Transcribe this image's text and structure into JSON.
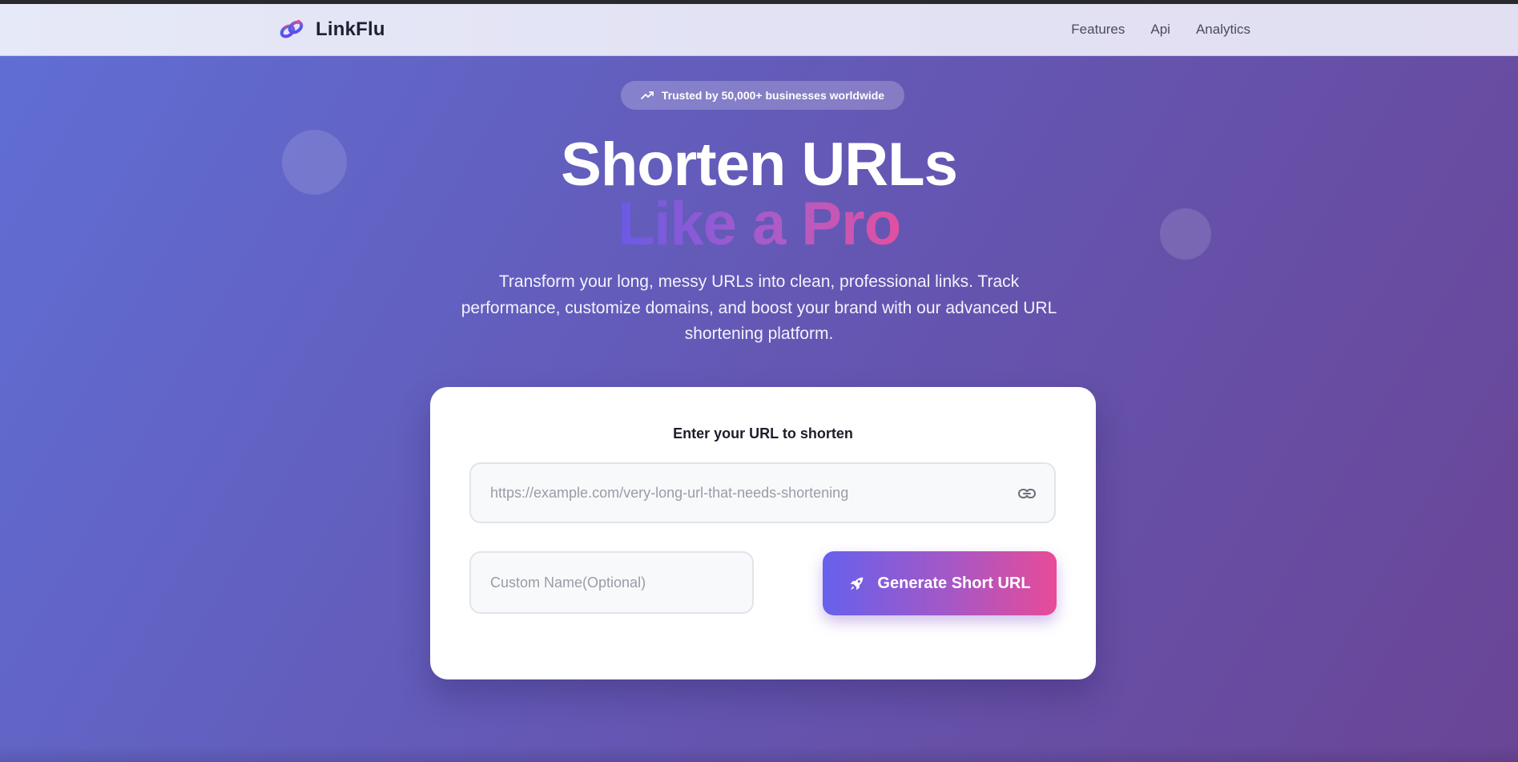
{
  "brand": {
    "name": "LinkFlu",
    "logo_icon": "infinity-link-logo-icon"
  },
  "nav": {
    "links": [
      "Features",
      "Api",
      "Analytics"
    ]
  },
  "hero": {
    "badge": {
      "icon": "trending-up-icon",
      "text": "Trusted by 50,000+ businesses worldwide"
    },
    "title_line1": "Shorten URLs",
    "title_line2": "Like a Pro",
    "description": "Transform your long, messy URLs into clean, professional links. Track performance, customize domains, and boost your brand with our advanced URL shortening platform."
  },
  "form": {
    "label": "Enter your URL to shorten",
    "url_placeholder": "https://example.com/very-long-url-that-needs-shortening",
    "url_value": "",
    "url_icon": "link-icon",
    "custom_placeholder": "Custom Name(Optional)",
    "custom_value": "",
    "submit_label": "Generate Short URL",
    "submit_icon": "rocket-icon"
  },
  "colors": {
    "hero_gradient_start": "#606ed4",
    "hero_gradient_end": "#6a4596",
    "accent_start": "#6661ec",
    "accent_end": "#e84b98",
    "navbar_bg": "#e4e6f6"
  }
}
